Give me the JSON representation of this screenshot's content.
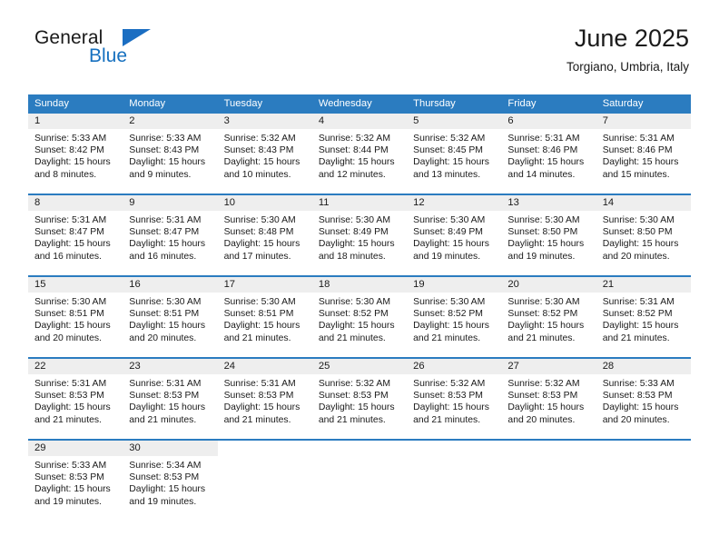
{
  "brand": {
    "word_one": "General",
    "word_two": "Blue",
    "icon": "triangle-logo-icon",
    "color": "#1b6ec2"
  },
  "header": {
    "title": "June 2025",
    "location": "Torgiano, Umbria, Italy"
  },
  "colors": {
    "header_band": "#2b7cc0",
    "daynum_band": "#eeeeee",
    "row_divider": "#2b7cc0",
    "text": "#1a1a1a"
  },
  "calendar": {
    "weekday_headers": [
      "Sunday",
      "Monday",
      "Tuesday",
      "Wednesday",
      "Thursday",
      "Friday",
      "Saturday"
    ],
    "weeks": [
      [
        {
          "day": "1",
          "sunrise": "Sunrise: 5:33 AM",
          "sunset": "Sunset: 8:42 PM",
          "daylight1": "Daylight: 15 hours",
          "daylight2": "and 8 minutes."
        },
        {
          "day": "2",
          "sunrise": "Sunrise: 5:33 AM",
          "sunset": "Sunset: 8:43 PM",
          "daylight1": "Daylight: 15 hours",
          "daylight2": "and 9 minutes."
        },
        {
          "day": "3",
          "sunrise": "Sunrise: 5:32 AM",
          "sunset": "Sunset: 8:43 PM",
          "daylight1": "Daylight: 15 hours",
          "daylight2": "and 10 minutes."
        },
        {
          "day": "4",
          "sunrise": "Sunrise: 5:32 AM",
          "sunset": "Sunset: 8:44 PM",
          "daylight1": "Daylight: 15 hours",
          "daylight2": "and 12 minutes."
        },
        {
          "day": "5",
          "sunrise": "Sunrise: 5:32 AM",
          "sunset": "Sunset: 8:45 PM",
          "daylight1": "Daylight: 15 hours",
          "daylight2": "and 13 minutes."
        },
        {
          "day": "6",
          "sunrise": "Sunrise: 5:31 AM",
          "sunset": "Sunset: 8:46 PM",
          "daylight1": "Daylight: 15 hours",
          "daylight2": "and 14 minutes."
        },
        {
          "day": "7",
          "sunrise": "Sunrise: 5:31 AM",
          "sunset": "Sunset: 8:46 PM",
          "daylight1": "Daylight: 15 hours",
          "daylight2": "and 15 minutes."
        }
      ],
      [
        {
          "day": "8",
          "sunrise": "Sunrise: 5:31 AM",
          "sunset": "Sunset: 8:47 PM",
          "daylight1": "Daylight: 15 hours",
          "daylight2": "and 16 minutes."
        },
        {
          "day": "9",
          "sunrise": "Sunrise: 5:31 AM",
          "sunset": "Sunset: 8:47 PM",
          "daylight1": "Daylight: 15 hours",
          "daylight2": "and 16 minutes."
        },
        {
          "day": "10",
          "sunrise": "Sunrise: 5:30 AM",
          "sunset": "Sunset: 8:48 PM",
          "daylight1": "Daylight: 15 hours",
          "daylight2": "and 17 minutes."
        },
        {
          "day": "11",
          "sunrise": "Sunrise: 5:30 AM",
          "sunset": "Sunset: 8:49 PM",
          "daylight1": "Daylight: 15 hours",
          "daylight2": "and 18 minutes."
        },
        {
          "day": "12",
          "sunrise": "Sunrise: 5:30 AM",
          "sunset": "Sunset: 8:49 PM",
          "daylight1": "Daylight: 15 hours",
          "daylight2": "and 19 minutes."
        },
        {
          "day": "13",
          "sunrise": "Sunrise: 5:30 AM",
          "sunset": "Sunset: 8:50 PM",
          "daylight1": "Daylight: 15 hours",
          "daylight2": "and 19 minutes."
        },
        {
          "day": "14",
          "sunrise": "Sunrise: 5:30 AM",
          "sunset": "Sunset: 8:50 PM",
          "daylight1": "Daylight: 15 hours",
          "daylight2": "and 20 minutes."
        }
      ],
      [
        {
          "day": "15",
          "sunrise": "Sunrise: 5:30 AM",
          "sunset": "Sunset: 8:51 PM",
          "daylight1": "Daylight: 15 hours",
          "daylight2": "and 20 minutes."
        },
        {
          "day": "16",
          "sunrise": "Sunrise: 5:30 AM",
          "sunset": "Sunset: 8:51 PM",
          "daylight1": "Daylight: 15 hours",
          "daylight2": "and 20 minutes."
        },
        {
          "day": "17",
          "sunrise": "Sunrise: 5:30 AM",
          "sunset": "Sunset: 8:51 PM",
          "daylight1": "Daylight: 15 hours",
          "daylight2": "and 21 minutes."
        },
        {
          "day": "18",
          "sunrise": "Sunrise: 5:30 AM",
          "sunset": "Sunset: 8:52 PM",
          "daylight1": "Daylight: 15 hours",
          "daylight2": "and 21 minutes."
        },
        {
          "day": "19",
          "sunrise": "Sunrise: 5:30 AM",
          "sunset": "Sunset: 8:52 PM",
          "daylight1": "Daylight: 15 hours",
          "daylight2": "and 21 minutes."
        },
        {
          "day": "20",
          "sunrise": "Sunrise: 5:30 AM",
          "sunset": "Sunset: 8:52 PM",
          "daylight1": "Daylight: 15 hours",
          "daylight2": "and 21 minutes."
        },
        {
          "day": "21",
          "sunrise": "Sunrise: 5:31 AM",
          "sunset": "Sunset: 8:52 PM",
          "daylight1": "Daylight: 15 hours",
          "daylight2": "and 21 minutes."
        }
      ],
      [
        {
          "day": "22",
          "sunrise": "Sunrise: 5:31 AM",
          "sunset": "Sunset: 8:53 PM",
          "daylight1": "Daylight: 15 hours",
          "daylight2": "and 21 minutes."
        },
        {
          "day": "23",
          "sunrise": "Sunrise: 5:31 AM",
          "sunset": "Sunset: 8:53 PM",
          "daylight1": "Daylight: 15 hours",
          "daylight2": "and 21 minutes."
        },
        {
          "day": "24",
          "sunrise": "Sunrise: 5:31 AM",
          "sunset": "Sunset: 8:53 PM",
          "daylight1": "Daylight: 15 hours",
          "daylight2": "and 21 minutes."
        },
        {
          "day": "25",
          "sunrise": "Sunrise: 5:32 AM",
          "sunset": "Sunset: 8:53 PM",
          "daylight1": "Daylight: 15 hours",
          "daylight2": "and 21 minutes."
        },
        {
          "day": "26",
          "sunrise": "Sunrise: 5:32 AM",
          "sunset": "Sunset: 8:53 PM",
          "daylight1": "Daylight: 15 hours",
          "daylight2": "and 21 minutes."
        },
        {
          "day": "27",
          "sunrise": "Sunrise: 5:32 AM",
          "sunset": "Sunset: 8:53 PM",
          "daylight1": "Daylight: 15 hours",
          "daylight2": "and 20 minutes."
        },
        {
          "day": "28",
          "sunrise": "Sunrise: 5:33 AM",
          "sunset": "Sunset: 8:53 PM",
          "daylight1": "Daylight: 15 hours",
          "daylight2": "and 20 minutes."
        }
      ],
      [
        {
          "day": "29",
          "sunrise": "Sunrise: 5:33 AM",
          "sunset": "Sunset: 8:53 PM",
          "daylight1": "Daylight: 15 hours",
          "daylight2": "and 19 minutes."
        },
        {
          "day": "30",
          "sunrise": "Sunrise: 5:34 AM",
          "sunset": "Sunset: 8:53 PM",
          "daylight1": "Daylight: 15 hours",
          "daylight2": "and 19 minutes."
        },
        {
          "day": "",
          "sunrise": "",
          "sunset": "",
          "daylight1": "",
          "daylight2": ""
        },
        {
          "day": "",
          "sunrise": "",
          "sunset": "",
          "daylight1": "",
          "daylight2": ""
        },
        {
          "day": "",
          "sunrise": "",
          "sunset": "",
          "daylight1": "",
          "daylight2": ""
        },
        {
          "day": "",
          "sunrise": "",
          "sunset": "",
          "daylight1": "",
          "daylight2": ""
        },
        {
          "day": "",
          "sunrise": "",
          "sunset": "",
          "daylight1": "",
          "daylight2": ""
        }
      ]
    ]
  }
}
